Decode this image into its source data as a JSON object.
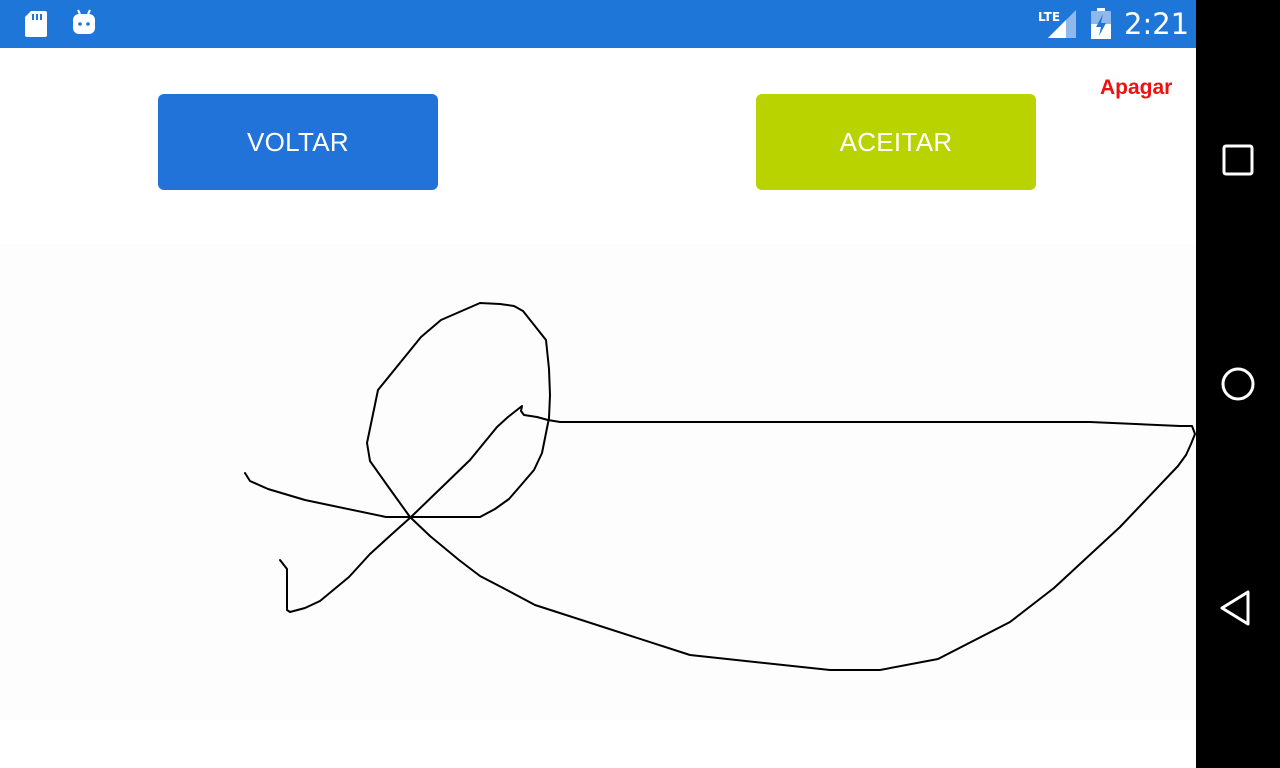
{
  "status_bar": {
    "time": "2:21",
    "network_label": "LTE",
    "icons": [
      "sd-card-icon",
      "android-debug-icon",
      "lte-signal-icon",
      "battery-charging-icon"
    ]
  },
  "toolbar": {
    "apagar_label": "Apagar",
    "voltar_label": "VOLTAR",
    "aceitar_label": "ACEITAR"
  },
  "colors": {
    "status_bar": "#1e77d8",
    "voltar_button": "#2173d9",
    "aceitar_button": "#b9d300",
    "apagar_text": "#ee1111",
    "signature_stroke": "#000000"
  },
  "navigation": {
    "buttons": [
      "recents-icon",
      "home-icon",
      "back-icon"
    ]
  }
}
